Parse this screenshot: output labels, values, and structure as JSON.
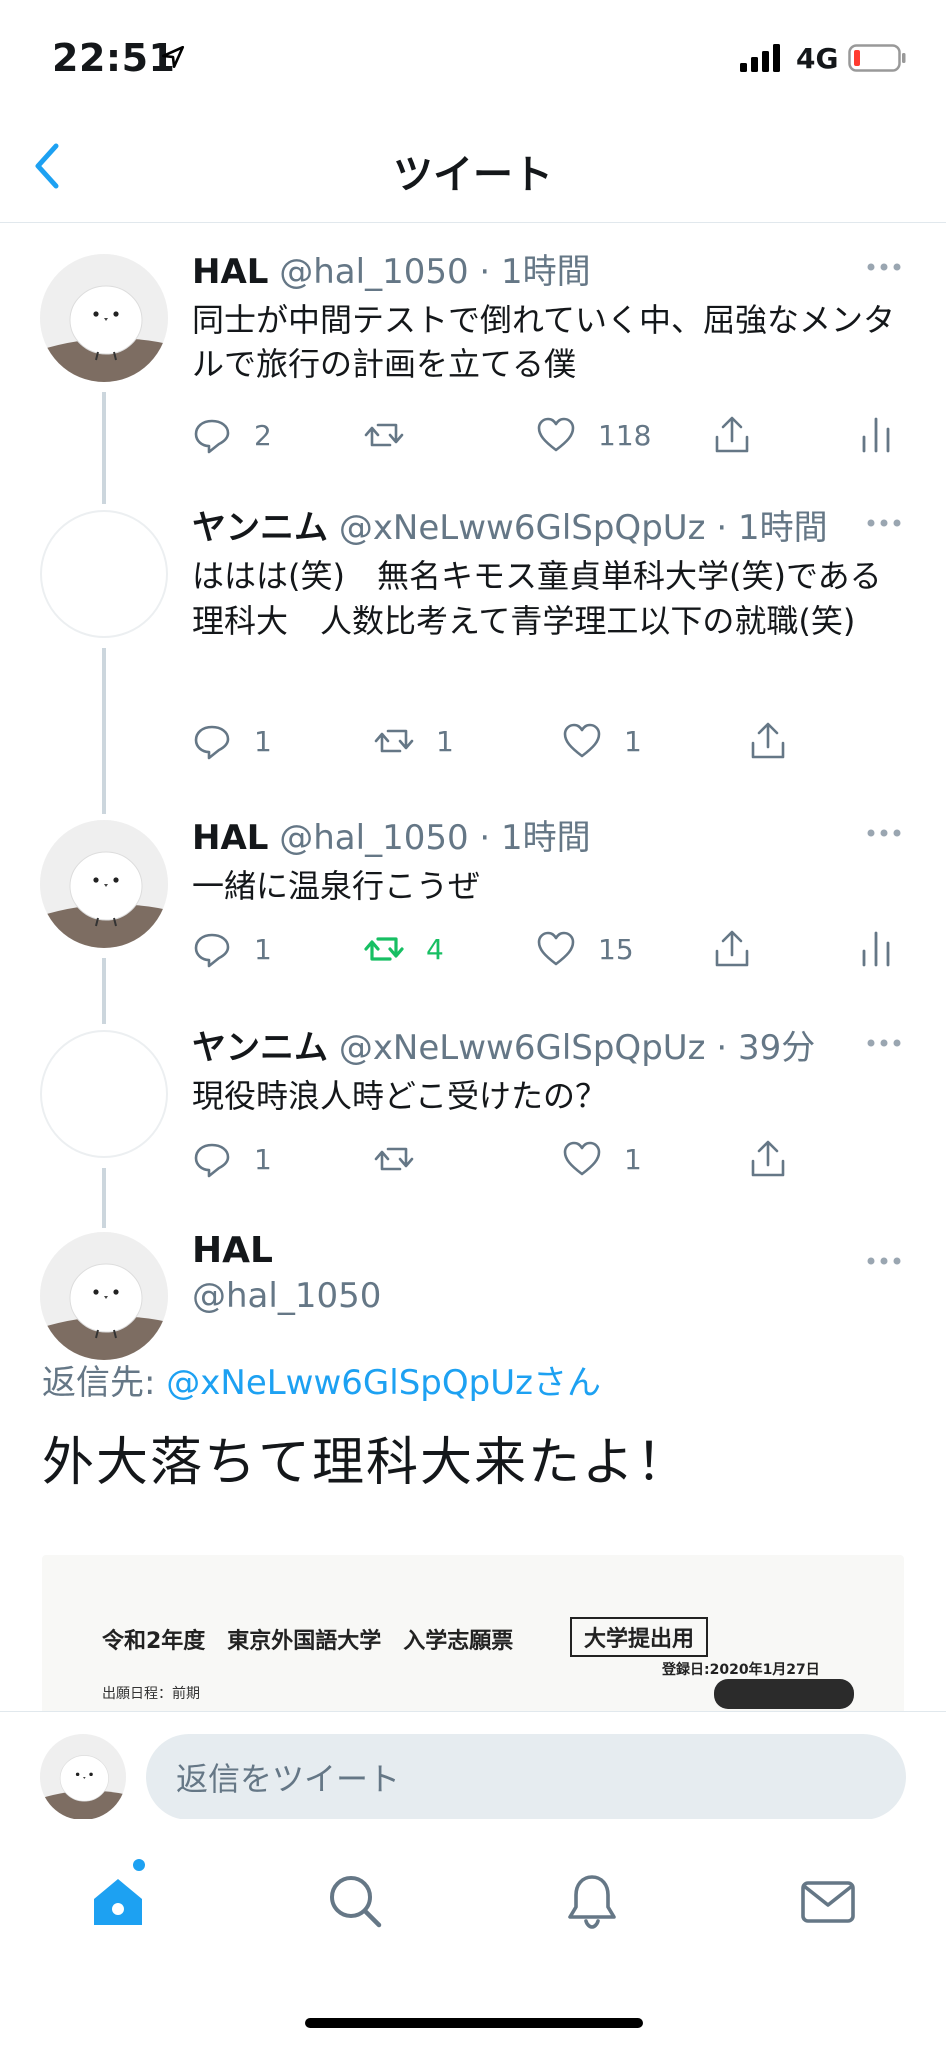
{
  "status_bar": {
    "time": "22:51",
    "network": "4G"
  },
  "nav": {
    "title": "ツイート"
  },
  "tweets": [
    {
      "name": "HAL",
      "handle": "@hal_1050",
      "time": "· 1時間",
      "text": "同士が中間テストで倒れていく中、屈強なメンタルで旅行の計画を立てる僕",
      "replies": "2",
      "retweets": "",
      "likes": "118"
    },
    {
      "name": "ヤンニム",
      "handle": "@xNeLww6GlSpQpUz",
      "time": "· 1時間",
      "text": "ははは(笑)　無名キモス童貞単科大学(笑)である理科大　人数比考えて青学理工以下の就職(笑)",
      "replies": "1",
      "retweets": "1",
      "likes": "1"
    },
    {
      "name": "HAL",
      "handle": "@hal_1050",
      "time": "· 1時間",
      "text": "一緒に温泉行こうぜ",
      "replies": "1",
      "retweets": "4",
      "likes": "15"
    },
    {
      "name": "ヤンニム",
      "handle": "@xNeLww6GlSpQpUz",
      "time": "· 39分",
      "text": "現役時浪人時どこ受けたの？",
      "replies": "1",
      "retweets": "",
      "likes": "1"
    }
  ],
  "focused": {
    "name": "HAL",
    "handle": "@hal_1050",
    "reply_prefix": "返信先: ",
    "reply_target": "@xNeLww6GlSpQpUzさん",
    "text": "外大落ちて理科大来たよ！",
    "attachment": {
      "title": "令和2年度　東京外国語大学　入学志願票",
      "stamp": "大学提出用",
      "date": "登録日:2020年1月27日",
      "sub": "出願日程：前期"
    }
  },
  "composer": {
    "placeholder": "返信をツイート"
  },
  "colors": {
    "accent": "#1da1f2",
    "retweet_active": "#17bf63",
    "secondary_text": "#657786",
    "icon_gray": "#657786",
    "divider": "#e1e8ed"
  },
  "icons": {
    "back": "chevron-left-icon",
    "more": "more-dots-icon",
    "reply": "reply-icon",
    "retweet": "retweet-icon",
    "like": "heart-icon",
    "share": "share-icon",
    "analytics": "analytics-icon",
    "home": "home-icon",
    "search": "search-icon",
    "notifications": "bell-icon",
    "messages": "mail-icon"
  }
}
